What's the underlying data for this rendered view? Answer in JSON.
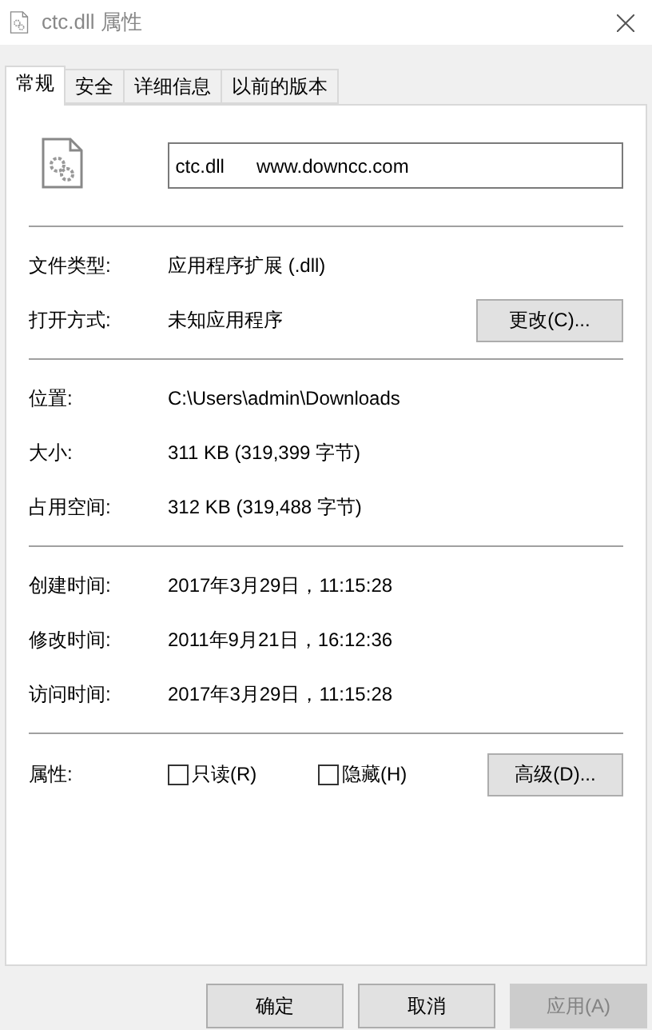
{
  "window": {
    "title": "ctc.dll 属性"
  },
  "tabs": [
    {
      "label": "常规",
      "selected": true
    },
    {
      "label": "安全",
      "selected": false
    },
    {
      "label": "详细信息",
      "selected": false
    },
    {
      "label": "以前的版本",
      "selected": false
    }
  ],
  "file": {
    "name": "ctc.dll      www.downcc.com"
  },
  "sections": [
    [
      {
        "label": "文件类型:",
        "value": "应用程序扩展 (.dll)"
      },
      {
        "label": "打开方式:",
        "value": "未知应用程序",
        "button": "更改(C)..."
      }
    ],
    [
      {
        "label": "位置:",
        "value": "C:\\Users\\admin\\Downloads"
      },
      {
        "label": "大小:",
        "value": "311 KB (319,399 字节)"
      },
      {
        "label": "占用空间:",
        "value": "312 KB (319,488 字节)"
      }
    ],
    [
      {
        "label": "创建时间:",
        "value": "2017年3月29日，11:15:28"
      },
      {
        "label": "修改时间:",
        "value": "2011年9月21日，16:12:36"
      },
      {
        "label": "访问时间:",
        "value": "2017年3月29日，11:15:28"
      }
    ]
  ],
  "attributes": {
    "label": "属性:",
    "checkboxes": [
      {
        "label": "只读(R)",
        "checked": false
      },
      {
        "label": "隐藏(H)",
        "checked": false
      }
    ],
    "button": "高级(D)..."
  },
  "buttons": [
    {
      "label": "确定",
      "disabled": false
    },
    {
      "label": "取消",
      "disabled": false
    },
    {
      "label": "应用(A)",
      "disabled": true
    }
  ]
}
